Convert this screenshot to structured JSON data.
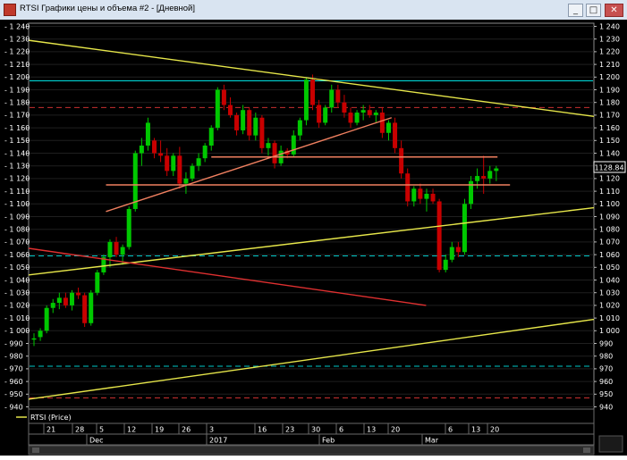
{
  "window": {
    "title": "RTSI Графики цены и объема #2 - [Дневной]",
    "buttons": {
      "minimize": "_",
      "maximize": "□",
      "close": "✕"
    }
  },
  "legend": {
    "label": "RTSI (Price)"
  },
  "price_badge": "1128.84",
  "chart_data": {
    "type": "candlestick",
    "series_name": "RTSI (Price)",
    "ylim": [
      940,
      1240
    ],
    "y_ticks": [
      940,
      950,
      960,
      970,
      980,
      990,
      1000,
      1010,
      1020,
      1030,
      1040,
      1050,
      1060,
      1070,
      1080,
      1090,
      1100,
      1110,
      1120,
      1130,
      1140,
      1150,
      1160,
      1170,
      1180,
      1190,
      1200,
      1210,
      1220,
      1230,
      1240
    ],
    "last_price": 1128.84,
    "x_day_labels": [
      "21",
      "28",
      "5",
      "12",
      "19",
      "26",
      "3",
      "16",
      "23",
      "30",
      "6",
      "13",
      "20",
      "6",
      "13",
      "20"
    ],
    "x_month_labels": [
      "Dec",
      "2017",
      "Feb",
      "Mar"
    ],
    "colors": {
      "up": "#00c800",
      "down": "#c80000",
      "background": "#000000",
      "axis_text": "#ffffff"
    },
    "candles": [
      [
        993,
        998,
        988,
        994
      ],
      [
        995,
        1002,
        992,
        1000
      ],
      [
        1000,
        1020,
        998,
        1018
      ],
      [
        1018,
        1025,
        1014,
        1022
      ],
      [
        1022,
        1030,
        1017,
        1026
      ],
      [
        1026,
        1030,
        1018,
        1020
      ],
      [
        1020,
        1032,
        1016,
        1030
      ],
      [
        1030,
        1034,
        1025,
        1028
      ],
      [
        1028,
        1030,
        1003,
        1006
      ],
      [
        1006,
        1032,
        1004,
        1030
      ],
      [
        1030,
        1048,
        1028,
        1046
      ],
      [
        1046,
        1060,
        1044,
        1058
      ],
      [
        1058,
        1072,
        1050,
        1070
      ],
      [
        1070,
        1074,
        1058,
        1060
      ],
      [
        1060,
        1068,
        1052,
        1066
      ],
      [
        1066,
        1098,
        1064,
        1096
      ],
      [
        1096,
        1142,
        1094,
        1140
      ],
      [
        1140,
        1152,
        1130,
        1146
      ],
      [
        1146,
        1168,
        1142,
        1164
      ],
      [
        1150,
        1152,
        1136,
        1140
      ],
      [
        1140,
        1150,
        1133,
        1138
      ],
      [
        1138,
        1144,
        1122,
        1126
      ],
      [
        1126,
        1140,
        1122,
        1138
      ],
      [
        1138,
        1145,
        1112,
        1116
      ],
      [
        1116,
        1125,
        1108,
        1120
      ],
      [
        1120,
        1132,
        1118,
        1130
      ],
      [
        1130,
        1140,
        1126,
        1136
      ],
      [
        1136,
        1148,
        1133,
        1146
      ],
      [
        1146,
        1162,
        1142,
        1160
      ],
      [
        1160,
        1192,
        1158,
        1190
      ],
      [
        1190,
        1194,
        1174,
        1178
      ],
      [
        1178,
        1184,
        1168,
        1170
      ],
      [
        1170,
        1172,
        1154,
        1158
      ],
      [
        1158,
        1178,
        1155,
        1174
      ],
      [
        1174,
        1176,
        1150,
        1154
      ],
      [
        1154,
        1172,
        1150,
        1168
      ],
      [
        1168,
        1170,
        1140,
        1144
      ],
      [
        1144,
        1152,
        1138,
        1148
      ],
      [
        1148,
        1150,
        1128,
        1132
      ],
      [
        1132,
        1146,
        1130,
        1142
      ],
      [
        1142,
        1144,
        1136,
        1139
      ],
      [
        1139,
        1158,
        1137,
        1154
      ],
      [
        1154,
        1168,
        1150,
        1166
      ],
      [
        1166,
        1200,
        1162,
        1198
      ],
      [
        1198,
        1202,
        1174,
        1178
      ],
      [
        1178,
        1182,
        1160,
        1164
      ],
      [
        1164,
        1178,
        1162,
        1176
      ],
      [
        1176,
        1194,
        1172,
        1190
      ],
      [
        1190,
        1194,
        1176,
        1180
      ],
      [
        1180,
        1186,
        1168,
        1172
      ],
      [
        1172,
        1176,
        1160,
        1164
      ],
      [
        1164,
        1174,
        1162,
        1172
      ],
      [
        1172,
        1178,
        1166,
        1174
      ],
      [
        1174,
        1178,
        1168,
        1170
      ],
      [
        1170,
        1174,
        1164,
        1172
      ],
      [
        1172,
        1176,
        1152,
        1156
      ],
      [
        1156,
        1166,
        1150,
        1164
      ],
      [
        1164,
        1168,
        1140,
        1144
      ],
      [
        1144,
        1150,
        1120,
        1124
      ],
      [
        1124,
        1128,
        1098,
        1102
      ],
      [
        1102,
        1114,
        1098,
        1112
      ],
      [
        1112,
        1116,
        1100,
        1104
      ],
      [
        1104,
        1112,
        1094,
        1108
      ],
      [
        1108,
        1112,
        1100,
        1102
      ],
      [
        1102,
        1104,
        1046,
        1048
      ],
      [
        1048,
        1060,
        1046,
        1056
      ],
      [
        1056,
        1070,
        1054,
        1066
      ],
      [
        1066,
        1070,
        1058,
        1062
      ],
      [
        1062,
        1104,
        1060,
        1100
      ],
      [
        1100,
        1122,
        1096,
        1118
      ],
      [
        1118,
        1128,
        1112,
        1122
      ],
      [
        1122,
        1138,
        1108,
        1120
      ],
      [
        1120,
        1130,
        1116,
        1126
      ],
      [
        1126,
        1130,
        1118,
        1128
      ]
    ],
    "horizontal_lines": [
      {
        "value": 1197,
        "color": "#00e0e0",
        "style": "solid"
      },
      {
        "value": 1176,
        "color": "#c83030",
        "style": "dashed"
      },
      {
        "value": 1059,
        "color": "#00c8c8",
        "style": "dashed"
      },
      {
        "value": 972,
        "color": "#00c8c8",
        "style": "dashed"
      },
      {
        "value": 947,
        "color": "#c83030",
        "style": "dashed"
      }
    ],
    "trend_lines": [
      {
        "from": [
          0,
          1229
        ],
        "to": [
          95,
          1169
        ],
        "color": "#e6e64a"
      },
      {
        "from": [
          0,
          1044
        ],
        "to": [
          95,
          1097
        ],
        "color": "#e6e64a"
      },
      {
        "from": [
          0,
          946
        ],
        "to": [
          95,
          1009
        ],
        "color": "#e6e64a"
      },
      {
        "from": [
          0,
          1065
        ],
        "to": [
          66.8,
          1020
        ],
        "color": "#e03030"
      },
      {
        "from": [
          13.0,
          1094
        ],
        "to": [
          61.0,
          1168
        ],
        "color": "#f08060"
      },
      {
        "from": [
          30.7,
          1137
        ],
        "to": [
          78.8,
          1137
        ],
        "color": "#f08060"
      },
      {
        "from": [
          13.0,
          1115
        ],
        "to": [
          80.9,
          1115
        ],
        "color": "#f08060"
      }
    ]
  }
}
